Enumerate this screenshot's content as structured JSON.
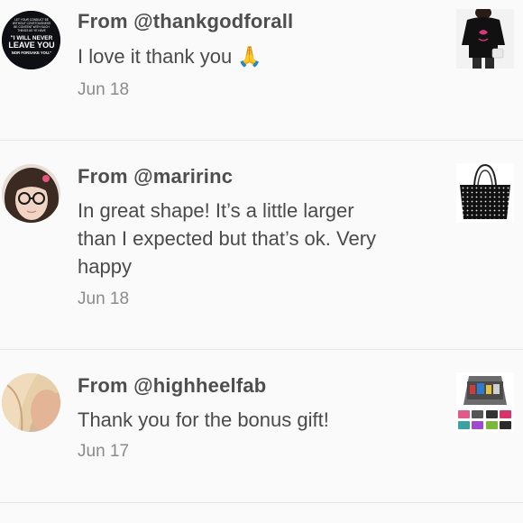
{
  "reviews": [
    {
      "from": "From @thankgodforall",
      "message": "I love it thank you",
      "emoji": "🙏",
      "date": "Jun 18",
      "avatar_text": [
        "LET YOUR CONDUCT BE",
        "WITHOUT COVETOUSNESS",
        "BE CONTENT WITH SUCH",
        "THINGS AS YE HAVE",
        "\"I WILL NEVER",
        "LEAVE YOU",
        "NOR FORSAKE YOU.\""
      ]
    },
    {
      "from": "From @maririnc",
      "message_lines": [
        "In great shape! It’s a little larger",
        "than I expected but that’s ok. Very",
        "happy"
      ],
      "date": "Jun 18"
    },
    {
      "from": "From @highheelfab",
      "message": "Thank you for the bonus gift!",
      "date": "Jun 17"
    }
  ]
}
